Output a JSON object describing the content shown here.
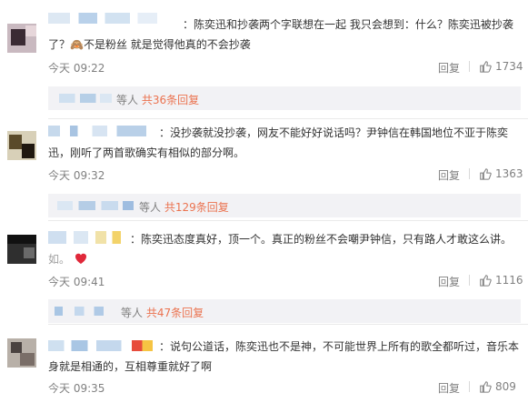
{
  "colors": {
    "link": "#eb7350",
    "meta": "#808080",
    "text": "#333333",
    "subreply_bg": "#f2f2f5",
    "heart": "#e0283a"
  },
  "comments": [
    {
      "text": "：陈奕迅和抄袭两个字联想在一起 我只会想到：什么？陈奕迅被抄袭了？🙈不是粉丝 就是觉得他真的不会抄袭",
      "time": "今天 09:22",
      "reply_label": "回复",
      "likes": "1734",
      "sub_prefix": "等人",
      "sub_more": "共36条回复"
    },
    {
      "text": "：没抄袭就没抄袭，网友不能好好说话吗？尹钟信在韩国地位不亚于陈奕迅，刚听了两首歌确实有相似的部分啊。",
      "time": "今天 09:32",
      "reply_label": "回复",
      "likes": "1363",
      "sub_prefix": "等人",
      "sub_more": "共129条回复"
    },
    {
      "text": "：陈奕迅态度真好，顶一个。真正的粉丝不会嘲尹钟信，只有路人才敢这么讲。",
      "text_tail": "如。",
      "time": "今天 09:41",
      "reply_label": "回复",
      "likes": "1116",
      "sub_prefix": "等人",
      "sub_more": "共47条回复"
    },
    {
      "text": "：说句公道话，陈奕迅也不是神，不可能世界上所有的歌全都听过，音乐本身就是相通的，互相尊重就好了啊",
      "time": "今天 09:35",
      "reply_label": "回复",
      "likes": "809"
    }
  ],
  "icons": {
    "like": "thumb-up-icon",
    "emoji_monkey": "see-no-evil-monkey-icon",
    "emoji_heart": "red-heart-icon"
  }
}
